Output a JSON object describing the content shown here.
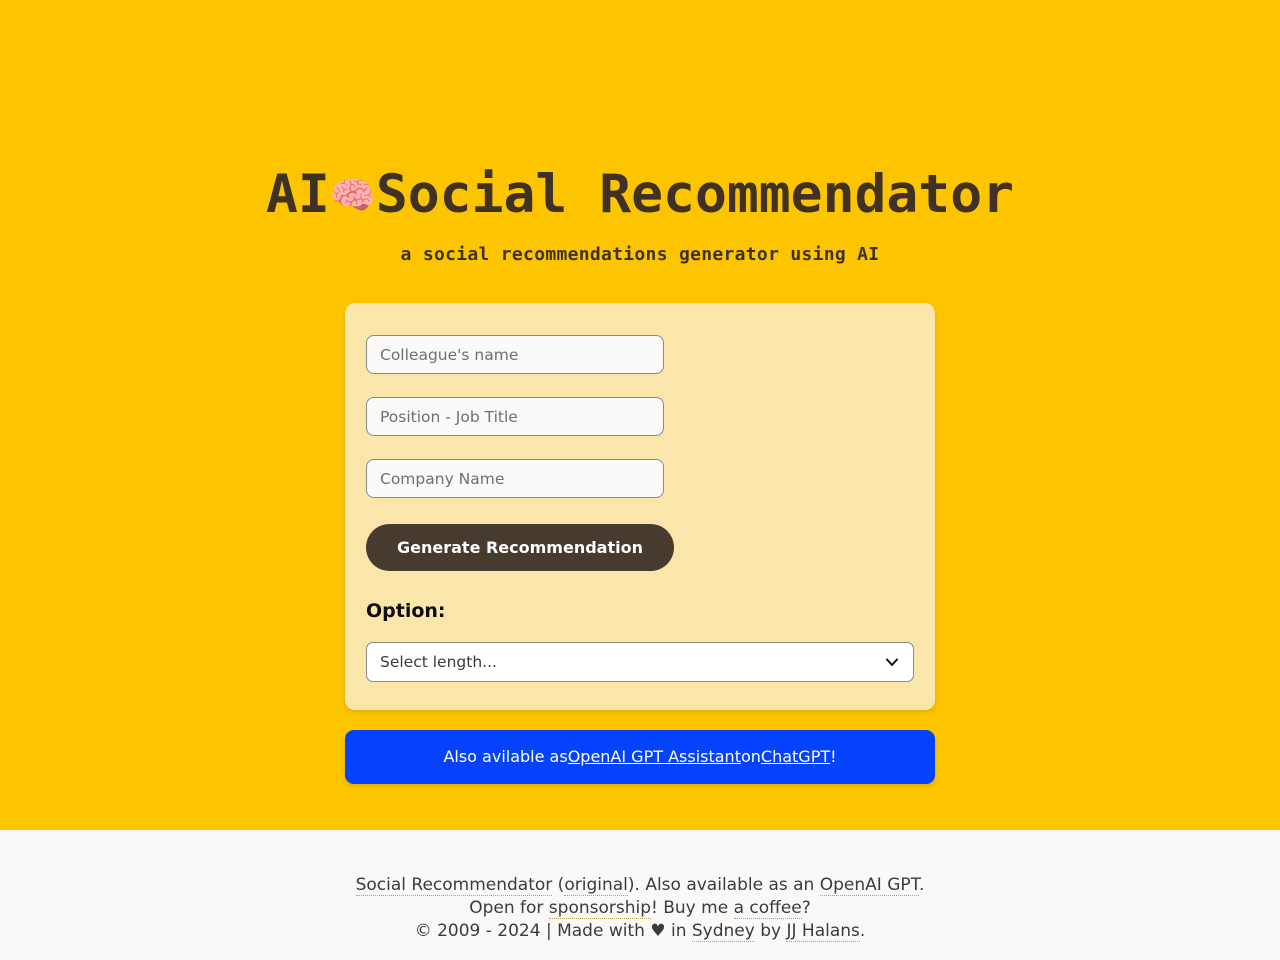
{
  "theme": {
    "page_background": "#FDC500",
    "card_background": "#FAE5AB",
    "footer_background": "#FAF9F7",
    "title_color": "#3F3225",
    "button_color": "#473A2E",
    "banner_color": "#0542FB",
    "link_underline_color": "#b9a055"
  },
  "header": {
    "title_prefix": "AI",
    "title_icon": "brain-icon",
    "title_icon_glyph": "🧠",
    "title_suffix": "Social Recommendator",
    "subtitle": "a social recommendations generator using AI"
  },
  "form": {
    "fields": [
      {
        "name": "colleague-name",
        "placeholder": "Colleague's name",
        "value": ""
      },
      {
        "name": "position-job-title",
        "placeholder": "Position - Job Title",
        "value": ""
      },
      {
        "name": "company-name",
        "placeholder": "Company Name",
        "value": ""
      }
    ],
    "generate_button_label": "Generate Recommendation",
    "option_label": "Option:",
    "length_select": {
      "selected": "Select length...",
      "options": [
        "Select length..."
      ]
    },
    "chevron_icon": "chevron-down-icon"
  },
  "promo_banner": {
    "text_before": "Also avilable as ",
    "link_1": "OpenAI GPT Assistant",
    "text_middle": " on ",
    "link_2": "ChatGPT",
    "text_after": "!"
  },
  "footer": {
    "line1": {
      "link_1": "Social Recommendator",
      "text_1": " (",
      "link_2": "original",
      "text_2": "). Also available as an ",
      "link_3": "OpenAI GPT",
      "text_3": "."
    },
    "line2": {
      "text_1": "Open for ",
      "link_1": "sponsorship",
      "text_2": "! Buy me ",
      "link_2": "a coffee",
      "text_3": "?"
    },
    "line3": {
      "text_1": "© 2009 - 2024 | Made with ",
      "heart": "♥",
      "text_2": " in ",
      "link_1": "Sydney",
      "text_3": " by ",
      "link_2": "JJ Halans",
      "text_4": "."
    }
  }
}
